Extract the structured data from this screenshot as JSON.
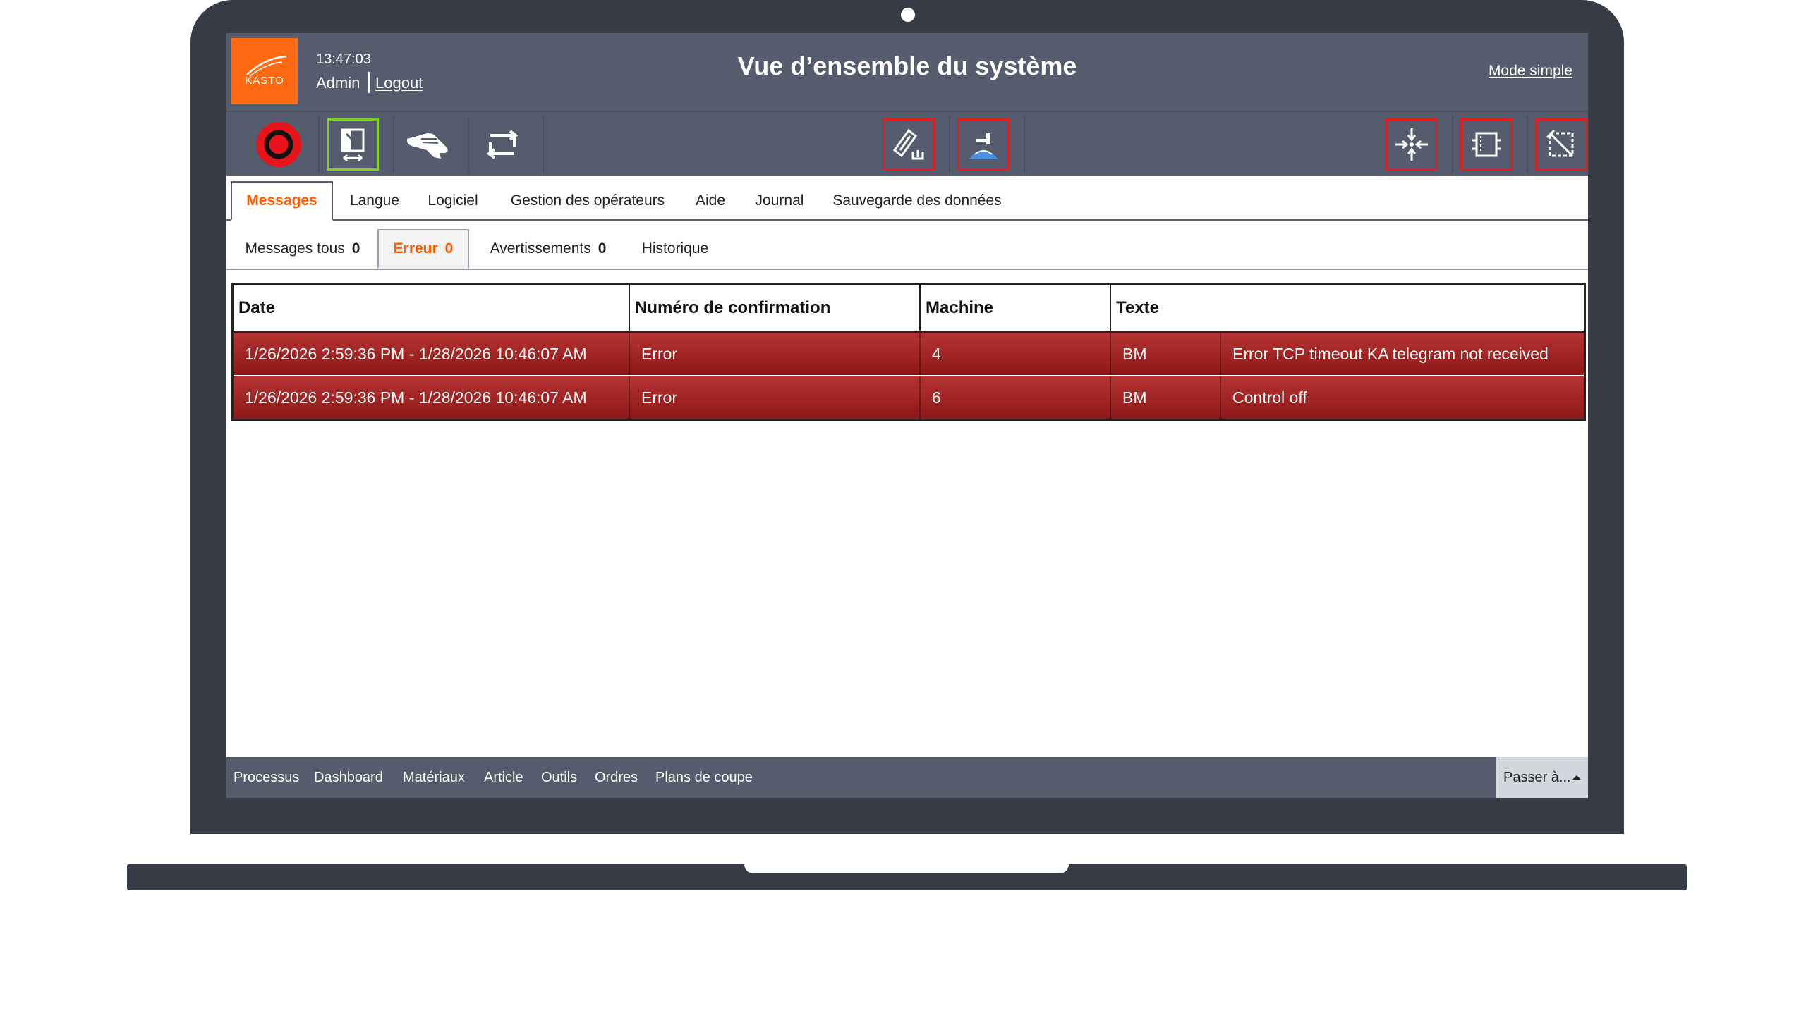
{
  "header": {
    "logo_text": "KASTO",
    "time": "13:47:03",
    "user": "Admin",
    "logout_label": "Logout",
    "title": "Vue d’ensemble du système",
    "mode_simple_label": "Mode simple",
    "background_color": "#555c6d",
    "logo_color": "#ff6a13"
  },
  "toolbar": {
    "left_buttons": [
      "stop-icon",
      "axis-move-icon",
      "manual-hand-icon",
      "cycle-icon"
    ],
    "center_buttons": [
      "blade-adjust-icon",
      "coolant-icon"
    ],
    "right_buttons": [
      "clamp-icon",
      "feed-icon",
      "cut-diagonal-icon"
    ],
    "alert_border_color": "#e02020",
    "active_border_color": "#7ed321"
  },
  "main_tabs": [
    {
      "label": "Messages",
      "active": true
    },
    {
      "label": "Langue"
    },
    {
      "label": "Logiciel"
    },
    {
      "label": "Gestion des opérateurs"
    },
    {
      "label": "Aide"
    },
    {
      "label": "Journal"
    },
    {
      "label": "Sauvegarde des données"
    }
  ],
  "sub_tabs": [
    {
      "label": "Messages tous",
      "count": "0"
    },
    {
      "label": "Erreur",
      "count": "0",
      "active": true
    },
    {
      "label": "Avertissements",
      "count": "0"
    },
    {
      "label": "Historique"
    }
  ],
  "table": {
    "headers": [
      "Date",
      "Numéro de confirmation",
      "Machine",
      "Texte"
    ],
    "rows": [
      {
        "date": "1/26/2026 2:59:36 PM - 1/28/2026 10:46:07 AM",
        "confirmation": "Error",
        "number": "4",
        "machine": "BM",
        "text": "Error TCP timeout KA telegram not received"
      },
      {
        "date": "1/26/2026 2:59:36 PM - 1/28/2026 10:46:07 AM",
        "confirmation": "Error",
        "number": "6",
        "machine": "BM",
        "text": "Control off"
      }
    ],
    "row_color": "#a52626"
  },
  "footer": {
    "links": [
      "Processus",
      "Dashboard",
      "Matériaux",
      "Article",
      "Outils",
      "Ordres",
      "Plans de coupe"
    ],
    "passer_label": "Passer à..."
  }
}
